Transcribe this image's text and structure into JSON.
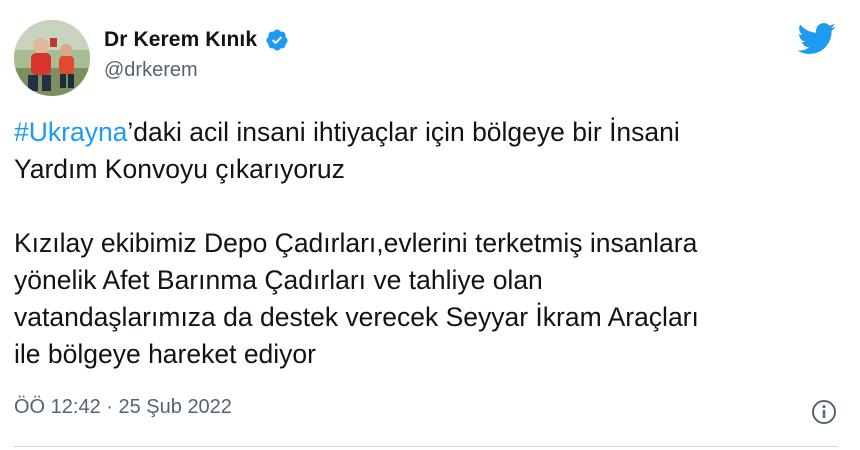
{
  "author": {
    "display_name": "Dr Kerem Kınık",
    "handle": "@drkerem",
    "verified": true
  },
  "tweet": {
    "hashtag": "#Ukrayna",
    "line1_rest": "’daki acil insani ihtiyaçlar için bölgeye bir İnsani",
    "line2": "Yardım Konvoyu çıkarıyoruz",
    "paragraph2": "Kızılay ekibimiz Depo Çadırları,evlerini terketmiş insanlara\nyönelik Afet Barınma Çadırları ve tahliye olan\nvatandaşlarımıza da destek verecek Seyyar İkram Araçları\nile bölgeye hareket ediyor",
    "timestamp": "ÖÖ 12:42 · 25 Şub 2022"
  },
  "icons": {
    "brand": "twitter-bird-icon",
    "verified": "verified-badge-icon",
    "info": "info-icon"
  },
  "colors": {
    "accent": "#1d9bf0",
    "text": "#0f1419",
    "muted": "#536471"
  }
}
